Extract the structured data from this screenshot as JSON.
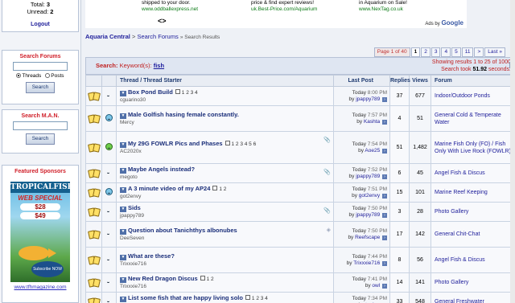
{
  "sidebar": {
    "user": {
      "total_label": "Total:",
      "total": "3",
      "unread_label": "Unread:",
      "unread": "2",
      "logout": "Logout"
    },
    "search_forums": {
      "title": "Search Forums",
      "input_value": "",
      "radio_threads": "Threads",
      "radio_posts": "Posts",
      "button": "Search"
    },
    "search_man": {
      "title": "Search M.A.N.",
      "input_value": "",
      "button": "Search"
    },
    "sponsors": {
      "title": "Featured Sponsors",
      "ad_brand": "TROPICALFISH",
      "ad_special": "WEB SPECIAL",
      "ad_price1": "$28",
      "ad_price2": "$49",
      "ad_subscribe": "Subscribe NOW",
      "ad_url": "www.tfhmagazine.com"
    }
  },
  "ads": {
    "ad1_line1": "shipped to your door.",
    "ad1_line2": "www.oddballexpress.net",
    "ad2_line1": "price & find expert reviews!",
    "ad2_line2": "uk.Best-Price.com/Aquarium",
    "ad3_line1": "in Aquarium on Sale!",
    "ad3_line2": "www.NexTag.co.uk",
    "nav": "<>",
    "by_label": "Ads by",
    "by_brand": "Google"
  },
  "breadcrumb": {
    "home": "Aquaria Central",
    "sep": ">",
    "current": "Search Forums",
    "tail": "» Search Results"
  },
  "pagination": {
    "label": "Page 1 of 40",
    "pages": [
      "1",
      "2",
      "3",
      "4",
      "5",
      "11",
      ">",
      "Last »"
    ]
  },
  "search": {
    "label": "Search:",
    "keyword_label": "Keyword(s):",
    "keyword": "fish",
    "stats_line1": "Showing results 1 to 25 of 1000",
    "stats_line2_prefix": "Search took",
    "stats_time": "51.92",
    "stats_line2_suffix": "seconds."
  },
  "table": {
    "headers": {
      "thread": "Thread / Thread Starter",
      "last_post": "Last Post",
      "replies": "Replies",
      "views": "Views",
      "forum": "Forum"
    },
    "rows": [
      {
        "title": "Box Pond Build",
        "pages": "1 2 3 4",
        "starter": "cguarino30",
        "date": "Today",
        "time": "8:00 PM",
        "by": "jpappy789",
        "replies": "37",
        "views": "677",
        "forum": "Indoor/Outdoor Ponds",
        "icon2": "blank"
      },
      {
        "title": "Male Golfish hasing female constantly.",
        "pages": "",
        "starter": "Mercy",
        "date": "Today",
        "time": "7:57 PM",
        "by": "Kashta",
        "replies": "4",
        "views": "51",
        "forum": "General Cold & Temperate Water",
        "icon2": "blue"
      },
      {
        "title": "My 29G FOWLR Pics and Phases",
        "pages": "1 2 3 4 5 6",
        "starter": "AC2020x",
        "date": "Today",
        "time": "7:54 PM",
        "by": "Aoe25",
        "replies": "51",
        "views": "1,482",
        "forum": "Marine Fish Only (FO) / Fish Only With Live Rock (FOWLR)",
        "icon2": "green"
      },
      {
        "title": "Maybe Angels instead?",
        "pages": "",
        "starter": "megoto",
        "date": "Today",
        "time": "7:52 PM",
        "by": "jpappy789",
        "replies": "6",
        "views": "45",
        "forum": "Angel Fish & Discus",
        "icon2": "blank"
      },
      {
        "title": "A 3 minute video of my AP24",
        "pages": "1 2",
        "starter": "got2envy",
        "date": "Today",
        "time": "7:51 PM",
        "by": "got2envy",
        "replies": "15",
        "views": "101",
        "forum": "Marine Reef Keeping",
        "icon2": "blue"
      },
      {
        "title": "Sids",
        "pages": "",
        "starter": "jpappy789",
        "date": "Today",
        "time": "7:50 PM",
        "by": "jpappy789",
        "replies": "3",
        "views": "28",
        "forum": "Photo Gallery",
        "icon2": "blank"
      },
      {
        "title": "Question about Tanichthys albonubes",
        "pages": "",
        "starter": "DeeSeven",
        "date": "Today",
        "time": "7:50 PM",
        "by": "Reefscape",
        "replies": "17",
        "views": "142",
        "forum": "General Chit-Chat",
        "icon2": "blank"
      },
      {
        "title": "What are these?",
        "pages": "",
        "starter": "Trixxxie716",
        "date": "Today",
        "time": "7:44 PM",
        "by": "Trixxxie716",
        "replies": "8",
        "views": "56",
        "forum": "Angel Fish & Discus",
        "icon2": "blank"
      },
      {
        "title": "New Red Dragon Discus",
        "pages": "1 2",
        "starter": "Trixxxie716",
        "date": "Today",
        "time": "7:41 PM",
        "by": "owl",
        "replies": "14",
        "views": "141",
        "forum": "Photo Gallery",
        "icon2": "blank"
      },
      {
        "title": "List some fish that are happy living solo",
        "pages": "1 2 3 4",
        "starter": "LeahK",
        "date": "Today",
        "time": "7:34 PM",
        "by": "tanker",
        "replies": "33",
        "views": "548",
        "forum": "General Freshwater",
        "icon2": "blank"
      }
    ]
  }
}
